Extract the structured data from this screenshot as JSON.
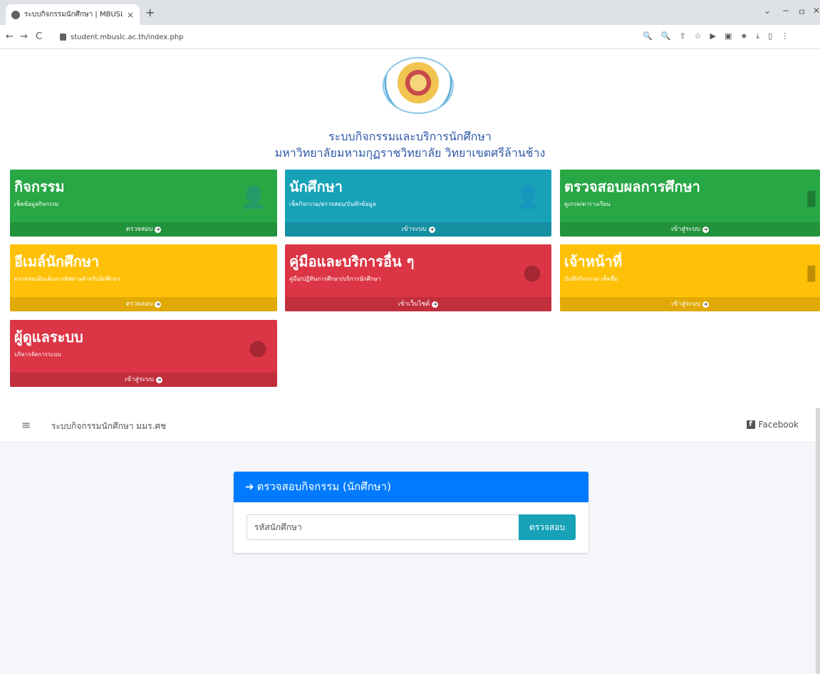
{
  "browser": {
    "tab_title": "ระบบกิจกรรมนักศึกษา | MBUSLC",
    "tab_close": "×",
    "new_tab": "+",
    "url": "student.mbuslc.ac.th/index.php",
    "nav": {
      "back": "←",
      "forward": "→",
      "reload": "C"
    },
    "window_controls": {
      "dropdown": "⌄",
      "minimize": "−",
      "restore": "ㅁ",
      "close": "✕"
    },
    "toolbar_icons": [
      "🔍",
      "🔍",
      "⇪",
      "☆",
      "▶",
      "▣",
      "★",
      "⤓",
      "▯",
      "⋮"
    ]
  },
  "header": {
    "title_line1": "ระบบกิจกรรมและบริการนักศึกษา",
    "title_line2": "มหาวิทยาลัยมหามกุฏราชวิทยาลัย วิทยาเขตศรีล้านช้าง"
  },
  "tiles": [
    {
      "title": "กิจกรรม",
      "subtitle": "เช็คข้อมูลกิจกรรม",
      "footer": "ตรวจสอบ",
      "icon": "user-plus-icon",
      "color": "#28a745"
    },
    {
      "title": "นักศึกษา",
      "subtitle": "เช็คกิจกรรม/ตรวจสอบ/บันทึกข้อมูล",
      "footer": "เข้าระบบ",
      "icon": "user-plus-icon",
      "color": "#17a2b8"
    },
    {
      "title": "ตรวจสอบผลการศึกษา",
      "subtitle": "ดูเกรด/ตารางเรียน",
      "footer": "เข้าสู่ระบบ",
      "icon": "bar-chart-icon",
      "color": "#28a745"
    },
    {
      "title": "อีเมล์นักศึกษา",
      "subtitle": "ตรวจสอบอีเมล์และรหัสผ่านสำหรับนักศึกษา",
      "footer": "ตรวจสอบ",
      "icon": "",
      "color": "#ffc107"
    },
    {
      "title": "คู่มือและบริการอื่น ๆ",
      "subtitle": "คู่มือ/ปฏิทินการศึกษา/บริการนักศึกษา",
      "footer": "เข้าเว็บไซต์",
      "icon": "pie-chart-icon",
      "color": "#dc3545"
    },
    {
      "title": "เจ้าหน้าที่",
      "subtitle": "บันทึกกิจกรรม เช็คชื่อ",
      "footer": "เข้าสู่ระบบ",
      "icon": "bar-chart-icon",
      "color": "#ffc107"
    },
    {
      "title": "ผู้ดูแลระบบ",
      "subtitle": "บริหารจัดการระบบ",
      "footer": "เข้าสู่ระบบ",
      "icon": "pie-chart-icon",
      "color": "#dc3545"
    }
  ],
  "app_nav": {
    "brand": "ระบบกิจกรรมนักศึกษา มมร.ศช",
    "facebook": "Facebook"
  },
  "check_card": {
    "header": "ตรวจสอบกิจกรรม (นักศึกษา)",
    "input_placeholder": "รหัสนักศึกษา",
    "button": "ตรวจสอบ"
  }
}
